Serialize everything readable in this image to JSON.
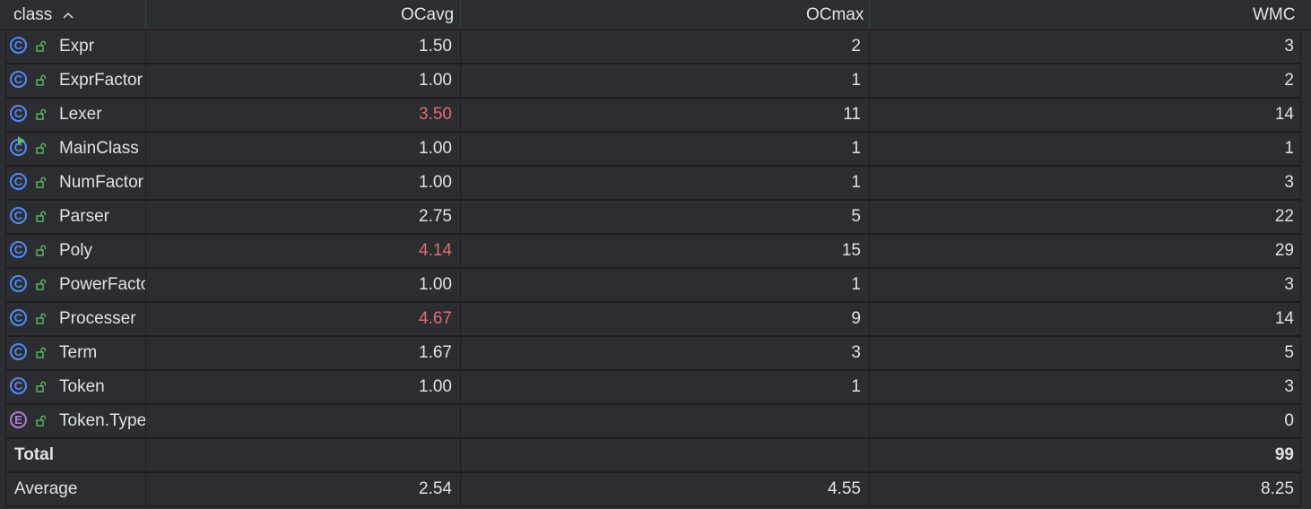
{
  "header": {
    "col_class": "class",
    "col_ocavg": "OCavg",
    "col_ocmax": "OCmax",
    "col_wmc": "WMC",
    "sort_icon": "chevron-up-icon"
  },
  "rows": [
    {
      "name": "Expr",
      "icon": "class-icon",
      "ocavg": "1.50",
      "ocmax": "2",
      "wmc": "3",
      "highlight": false
    },
    {
      "name": "ExprFactor",
      "icon": "class-icon",
      "ocavg": "1.00",
      "ocmax": "1",
      "wmc": "2",
      "highlight": false
    },
    {
      "name": "Lexer",
      "icon": "class-icon",
      "ocavg": "3.50",
      "ocmax": "11",
      "wmc": "14",
      "highlight": true
    },
    {
      "name": "MainClass",
      "icon": "runnable-class-icon",
      "ocavg": "1.00",
      "ocmax": "1",
      "wmc": "1",
      "highlight": false
    },
    {
      "name": "NumFactor",
      "icon": "class-icon",
      "ocavg": "1.00",
      "ocmax": "1",
      "wmc": "3",
      "highlight": false
    },
    {
      "name": "Parser",
      "icon": "class-icon",
      "ocavg": "2.75",
      "ocmax": "5",
      "wmc": "22",
      "highlight": false
    },
    {
      "name": "Poly",
      "icon": "class-icon",
      "ocavg": "4.14",
      "ocmax": "15",
      "wmc": "29",
      "highlight": true
    },
    {
      "name": "PowerFactor",
      "icon": "class-icon",
      "ocavg": "1.00",
      "ocmax": "1",
      "wmc": "3",
      "highlight": false
    },
    {
      "name": "Processer",
      "icon": "class-icon",
      "ocavg": "4.67",
      "ocmax": "9",
      "wmc": "14",
      "highlight": true
    },
    {
      "name": "Term",
      "icon": "class-icon",
      "ocavg": "1.67",
      "ocmax": "3",
      "wmc": "5",
      "highlight": false
    },
    {
      "name": "Token",
      "icon": "class-icon",
      "ocavg": "1.00",
      "ocmax": "1",
      "wmc": "3",
      "highlight": false
    },
    {
      "name": "Token.Type",
      "icon": "enum-icon",
      "ocavg": "",
      "ocmax": "",
      "wmc": "0",
      "highlight": false
    }
  ],
  "total": {
    "label": "Total",
    "ocavg": "",
    "ocmax": "",
    "wmc": "99"
  },
  "average": {
    "label": "Average",
    "ocavg": "2.54",
    "ocmax": "4.55",
    "wmc": "8.25"
  },
  "colors": {
    "class_icon": "#548af7",
    "enum_icon": "#b07cd8",
    "lock_icon": "#5fb865",
    "warning_value": "#e06c75"
  },
  "icon_letters": {
    "class": "C",
    "enum": "E"
  }
}
